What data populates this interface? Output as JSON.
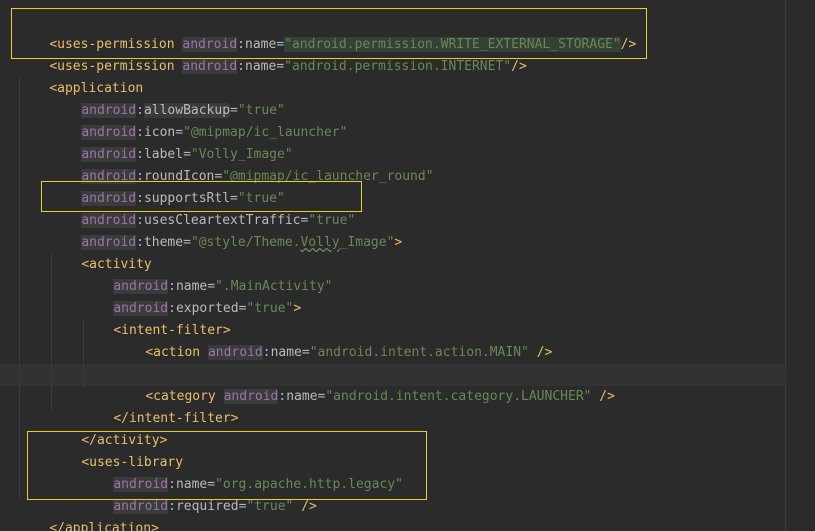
{
  "lines": {
    "l1": {
      "open": "<",
      "tag": "uses-permission",
      "ns": "android",
      "attr": "name",
      "eq": "=",
      "value": "\"android.permission.WRITE_EXTERNAL_STORAGE\"",
      "close": "/>"
    },
    "l2": {
      "open": "<",
      "tag": "uses-permission",
      "ns": "android",
      "attr": "name",
      "eq": "=",
      "value": "\"android.permission.INTERNET\"",
      "close": "/>"
    },
    "l3": {
      "open": "<",
      "tag": "application"
    },
    "l4": {
      "ns": "android",
      "attr": "allowBackup",
      "eq": "=",
      "value": "\"true\""
    },
    "l5": {
      "ns": "android",
      "attr": "icon",
      "eq": "=",
      "value": "\"@mipmap/ic_launcher\""
    },
    "l6": {
      "ns": "android",
      "attr": "label",
      "eq": "=",
      "value": "\"Volly_Image\""
    },
    "l7": {
      "ns": "android",
      "attr": "roundIcon",
      "eq": "=",
      "value": "\"@mipmap/ic_launcher_round\""
    },
    "l8": {
      "ns": "android",
      "attr": "supportsRtl",
      "eq": "=",
      "value": "\"true\""
    },
    "l9": {
      "ns": "android",
      "attr": "usesCleartextTraffic",
      "eq": "=",
      "value": "\"true\""
    },
    "l10": {
      "ns": "android",
      "attr": "theme",
      "eq": "=",
      "value_a": "\"@style/Theme.",
      "value_b": "Volly",
      "value_c": "_Image\"",
      "close": ">"
    },
    "l11": {
      "open": "<",
      "tag": "activity"
    },
    "l12": {
      "ns": "android",
      "attr": "name",
      "eq": "=",
      "value": "\".MainActivity\""
    },
    "l13": {
      "ns": "android",
      "attr": "exported",
      "eq": "=",
      "value": "\"true\"",
      "close": ">"
    },
    "l14": {
      "open": "<",
      "tag": "intent-filter",
      "close": ">"
    },
    "l15": {
      "open": "<",
      "tag": "action",
      "ns": "android",
      "attr": "name",
      "eq": "=",
      "value": "\"android.intent.action.MAIN\"",
      "close": "/>"
    },
    "l17": {
      "open": "<",
      "tag": "category",
      "ns": "android",
      "attr": "name",
      "eq": "=",
      "value": "\"android.intent.category.LAUNCHER\"",
      "close": "/>"
    },
    "l18": {
      "open": "</",
      "tag": "intent-filter",
      "close": ">"
    },
    "l19": {
      "open": "</",
      "tag": "activity",
      "close": ">"
    },
    "l20": {
      "open": "<",
      "tag": "uses-library"
    },
    "l21": {
      "ns": "android",
      "attr": "name",
      "eq": "=",
      "value": "\"org.apache.http.legacy\""
    },
    "l22": {
      "ns": "android",
      "attr": "required",
      "eq": "=",
      "value": "\"true\"",
      "close": "/>"
    },
    "l23": {
      "open": "</",
      "tag": "application",
      "close": ">"
    }
  },
  "colors": {
    "background": "#2b2b2b",
    "tag": "#e8bf6a",
    "namespace": "#9876aa",
    "value": "#6a8759",
    "highlight_box": "#e6d21e"
  }
}
